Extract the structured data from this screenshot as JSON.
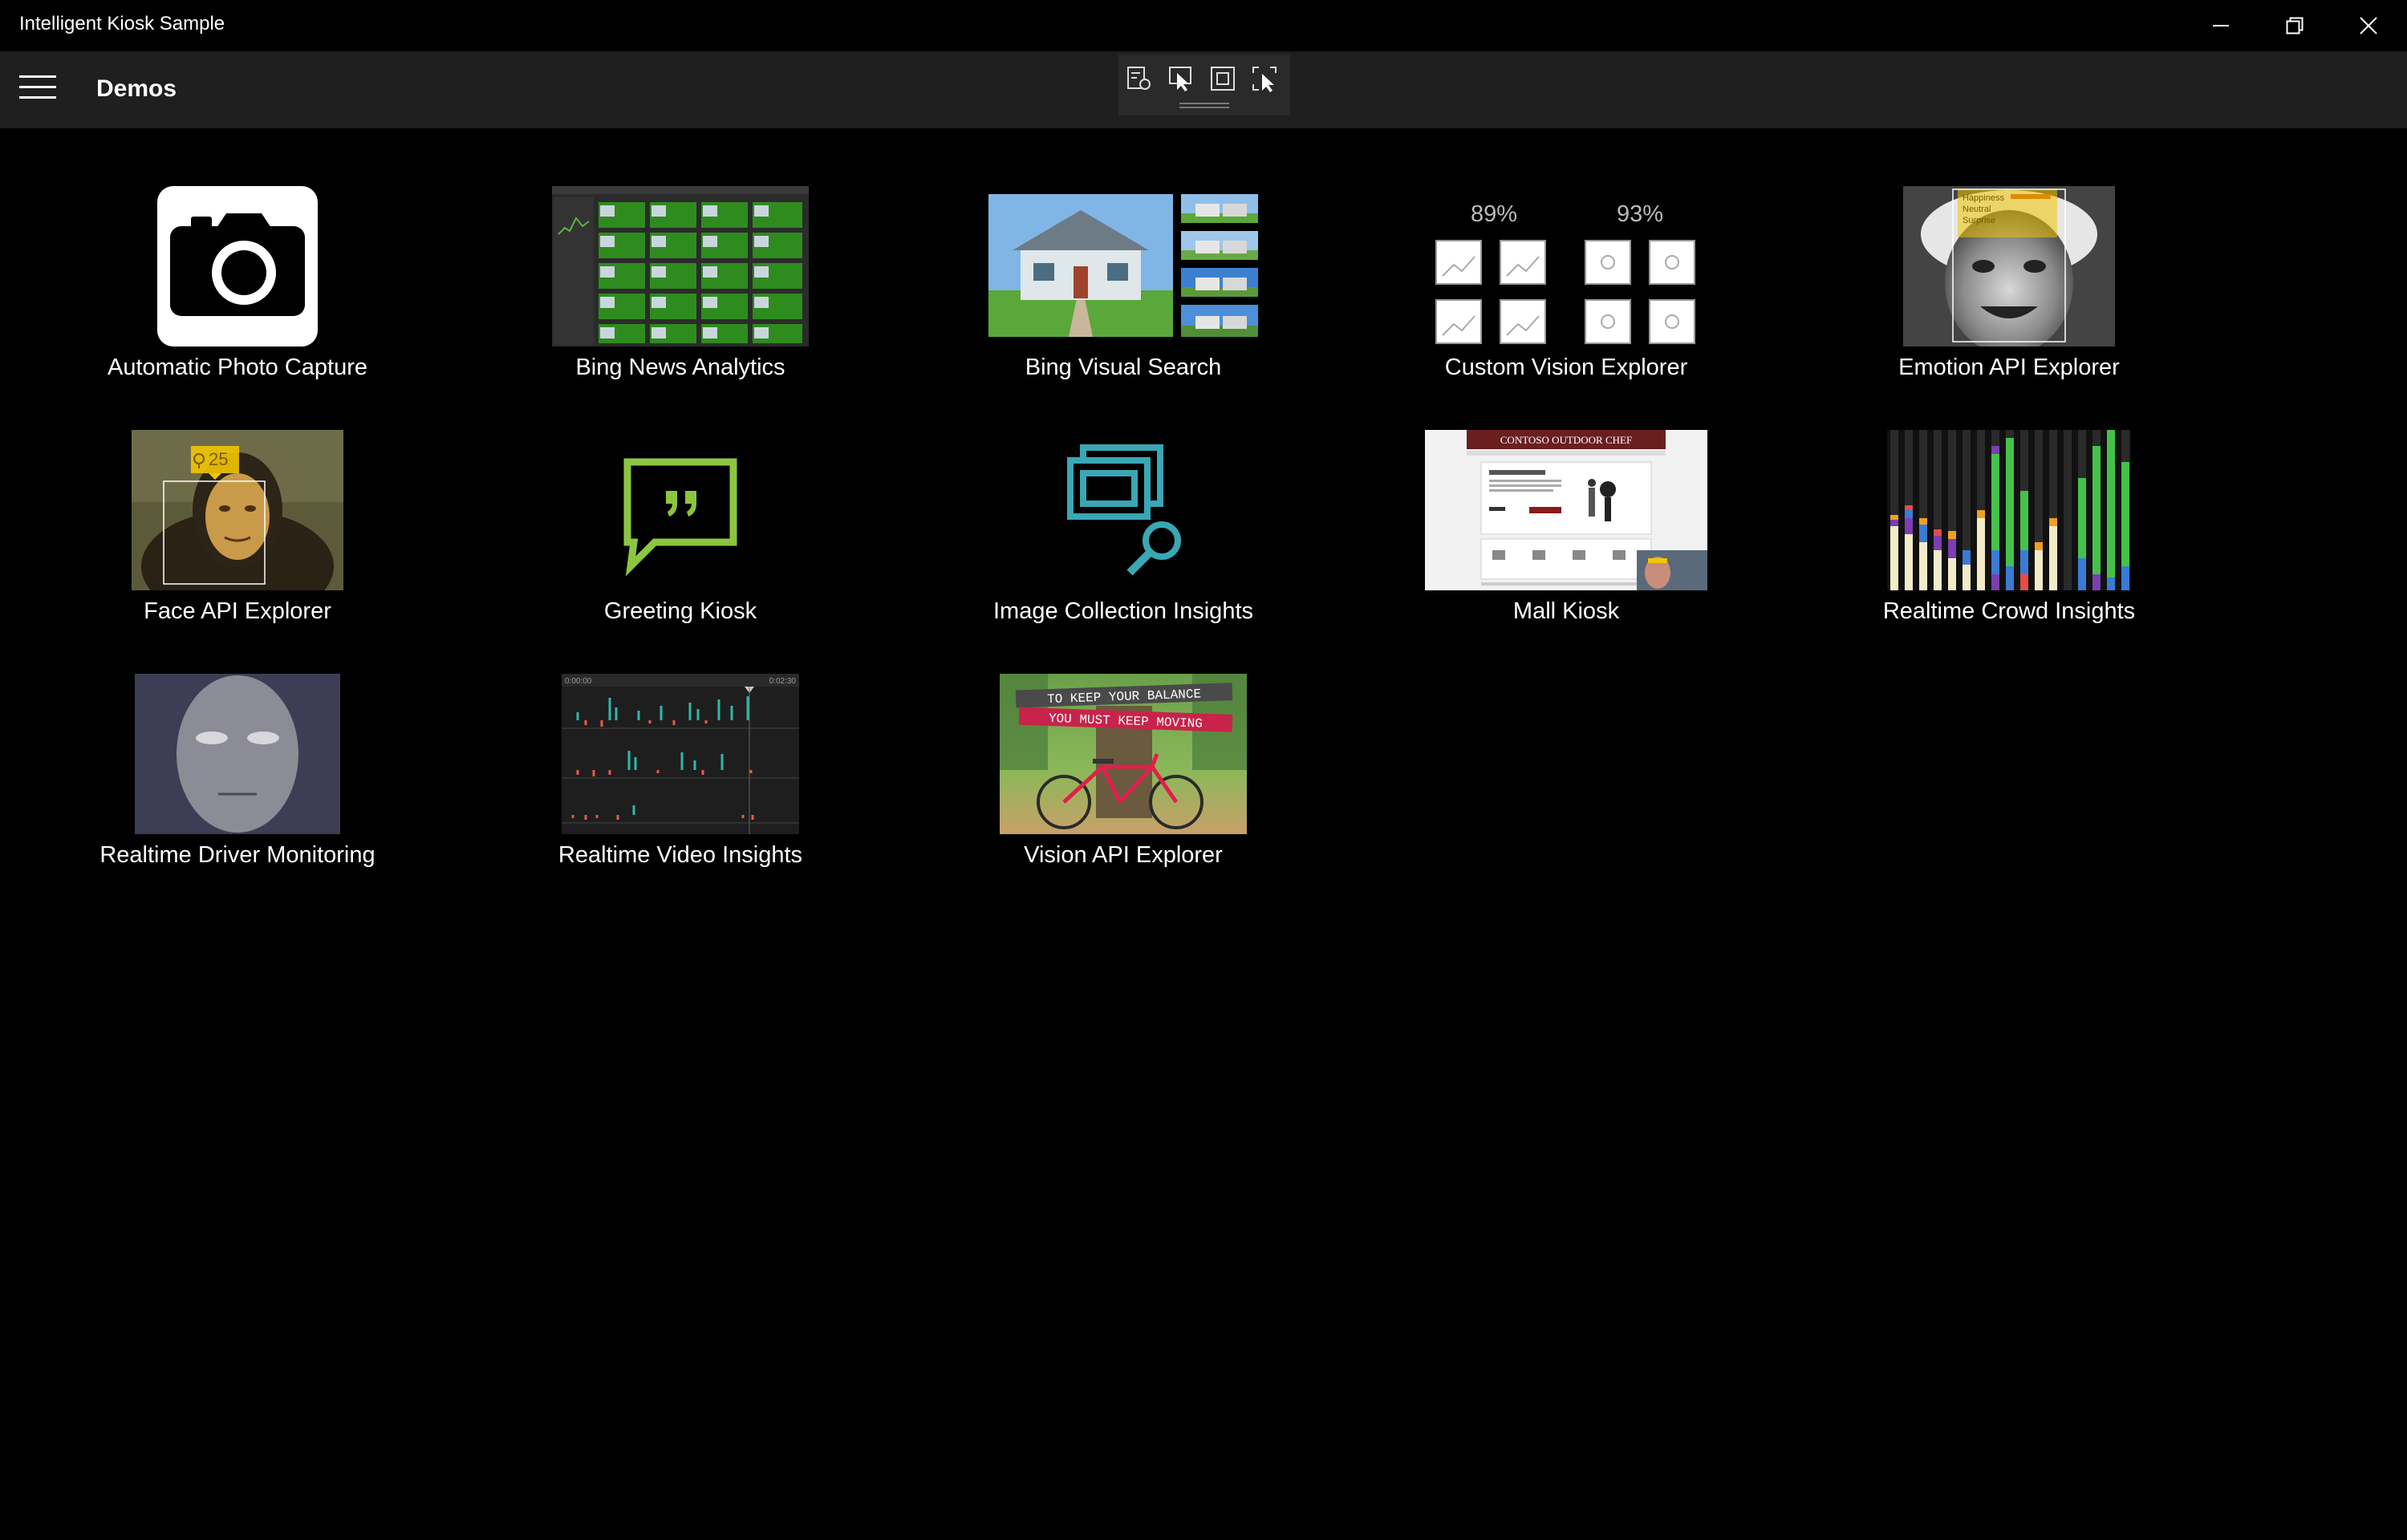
{
  "window": {
    "title": "Intelligent Kiosk Sample",
    "controls": [
      "minimize-icon",
      "restore-icon",
      "close-icon"
    ]
  },
  "appbar": {
    "title": "Demos",
    "menu_icon": "hamburger-menu-icon"
  },
  "debug_toolbar": {
    "icons": [
      "live-visual-tree-icon",
      "select-element-icon",
      "display-layout-adorners-icon",
      "track-focus-icon"
    ]
  },
  "demos": [
    {
      "label": "Automatic Photo Capture",
      "icon": "camera-icon"
    },
    {
      "label": "Bing News Analytics",
      "icon": "news-dashboard-thumbnail"
    },
    {
      "label": "Bing Visual Search",
      "icon": "house-search-thumbnail"
    },
    {
      "label": "Custom Vision Explorer",
      "icon": "custom-vision-thumbnail",
      "scores": [
        "89%",
        "93%"
      ]
    },
    {
      "label": "Emotion API Explorer",
      "icon": "emotion-face-thumbnail",
      "emotions": [
        "Happiness",
        "Neutral",
        "Surprise"
      ]
    },
    {
      "label": "Face API Explorer",
      "icon": "mona-lisa-face-thumbnail",
      "age": "25"
    },
    {
      "label": "Greeting Kiosk",
      "icon": "speech-bubble-icon"
    },
    {
      "label": "Image Collection Insights",
      "icon": "image-collection-search-icon"
    },
    {
      "label": "Mall Kiosk",
      "icon": "mall-kiosk-thumbnail",
      "banner": "CONTOSO OUTDOOR CHEF"
    },
    {
      "label": "Realtime Crowd Insights",
      "icon": "crowd-bars-thumbnail"
    },
    {
      "label": "Realtime Driver Monitoring",
      "icon": "driver-face-thumbnail"
    },
    {
      "label": "Realtime Video Insights",
      "icon": "video-timeline-thumbnail",
      "time_start": "0:00:00",
      "time_end": "0:02:30"
    },
    {
      "label": "Vision API Explorer",
      "icon": "bicycle-photo-thumbnail",
      "caption_lines": [
        "TO KEEP YOUR BALANCE",
        "YOU MUST KEEP MOVING"
      ]
    }
  ],
  "colors": {
    "background": "#000000",
    "appbar": "#1f1f1f",
    "greeting_green": "#8cc63f",
    "insights_teal": "#3aa7b5"
  }
}
